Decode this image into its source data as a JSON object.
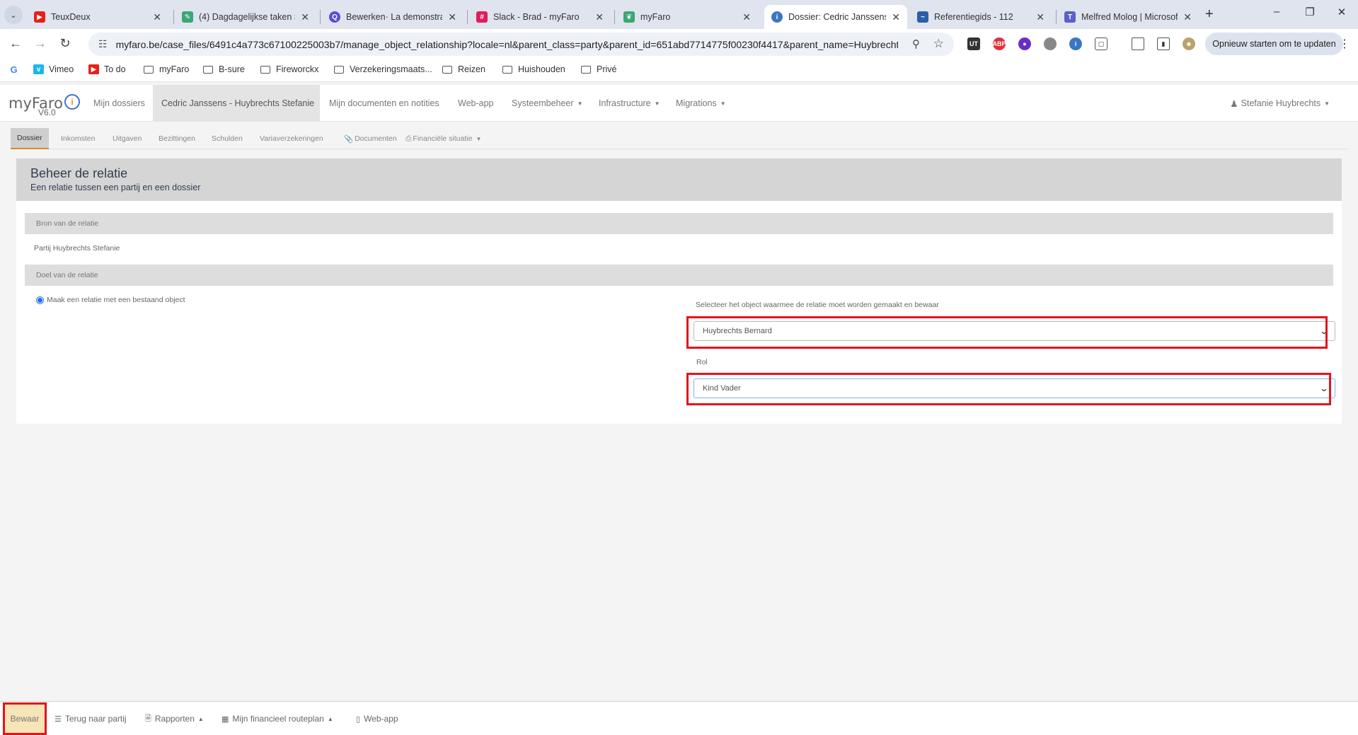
{
  "browser": {
    "tabs": [
      {
        "title": "TeuxDeux",
        "icon": "youtube-red-icon",
        "color": "#e62117"
      },
      {
        "title": "(4) Dagdagelijkse taken Sl",
        "icon": "feather-icon",
        "color": "#3aa776"
      },
      {
        "title": "Bewerken· La demonstrati",
        "icon": "search-bubble-icon",
        "color": "#5b4bdb"
      },
      {
        "title": "Slack - Brad - myFaro",
        "icon": "slack-icon",
        "color": "#e01e5a"
      },
      {
        "title": "myFaro",
        "icon": "leaf-icon",
        "color": "#3aa776"
      },
      {
        "title": "Dossier: Cedric Janssens -",
        "icon": "faro-icon",
        "color": "#3a76c4"
      },
      {
        "title": "Referentiegids - 112",
        "icon": "zigzag-icon",
        "color": "#2b5fa8"
      },
      {
        "title": "Melfred Molog | Microsof",
        "icon": "teams-icon",
        "color": "#5b5fc7"
      }
    ],
    "active_tab": 5,
    "url": "myfaro.be/case_files/6491c4a773c67100225003b7/manage_object_relationship?locale=nl&parent_class=party&parent_id=651abd7714775f00230f4417&parent_name=Huybrechts...",
    "update_button": "Opnieuw starten om te updaten",
    "bookmarks": [
      {
        "label": "",
        "type": "google"
      },
      {
        "label": "Vimeo",
        "type": "vimeo"
      },
      {
        "label": "To do",
        "type": "todo"
      },
      {
        "label": "myFaro",
        "type": "folder"
      },
      {
        "label": "B-sure",
        "type": "folder"
      },
      {
        "label": "Fireworckx",
        "type": "folder"
      },
      {
        "label": "Verzekeringsmaats...",
        "type": "folder"
      },
      {
        "label": "Reizen",
        "type": "folder"
      },
      {
        "label": "Huishouden",
        "type": "folder"
      },
      {
        "label": "Privé",
        "type": "folder"
      }
    ]
  },
  "app": {
    "logo": "myFaro",
    "version": "V6.0",
    "nav": [
      {
        "label": "Mijn dossiers"
      },
      {
        "label": "Cedric Janssens - Huybrechts Stefanie",
        "active": true
      },
      {
        "label": "Mijn documenten en notities"
      },
      {
        "label": "Web-app"
      },
      {
        "label": "Systeembeheer",
        "dropdown": true
      },
      {
        "label": "Infrastructure",
        "dropdown": true
      },
      {
        "label": "Migrations",
        "dropdown": true
      }
    ],
    "user": "Stefanie Huybrechts",
    "subtabs": [
      {
        "label": "Dossier",
        "active": true
      },
      {
        "label": "Inkomsten"
      },
      {
        "label": "Uitgaven"
      },
      {
        "label": "Bezittingen"
      },
      {
        "label": "Schulden"
      },
      {
        "label": "Variaverzekeringen"
      },
      {
        "label": "Documenten",
        "icon": "paperclip-icon"
      },
      {
        "label": "Financiële situatie",
        "icon": "printer-icon",
        "dropdown": true
      }
    ]
  },
  "panel": {
    "title": "Beheer de relatie",
    "subtitle": "Een relatie tussen een partij en een dossier",
    "source_header": "Bron van de relatie",
    "source_value": "Partij Huybrechts Stefanie",
    "target_header": "Doel van de relatie",
    "radio_label": "Maak een relatie met een bestaand object",
    "select_object_label": "Selecteer het object waarmee de relatie moet worden gemaakt en bewaar",
    "select_object_value": "Huybrechts Bernard",
    "role_label": "Rol",
    "role_value": "Kind Vader"
  },
  "footer": {
    "save": "Bewaar",
    "back": "Terug naar partij",
    "reports": "Rapporten",
    "routeplan": "Mijn financieel routeplan",
    "webapp": "Web-app"
  },
  "colors": {
    "highlight": "#e2141d",
    "save_bg": "#f7e5b7",
    "active_subtab_border": "#d98a2b"
  }
}
